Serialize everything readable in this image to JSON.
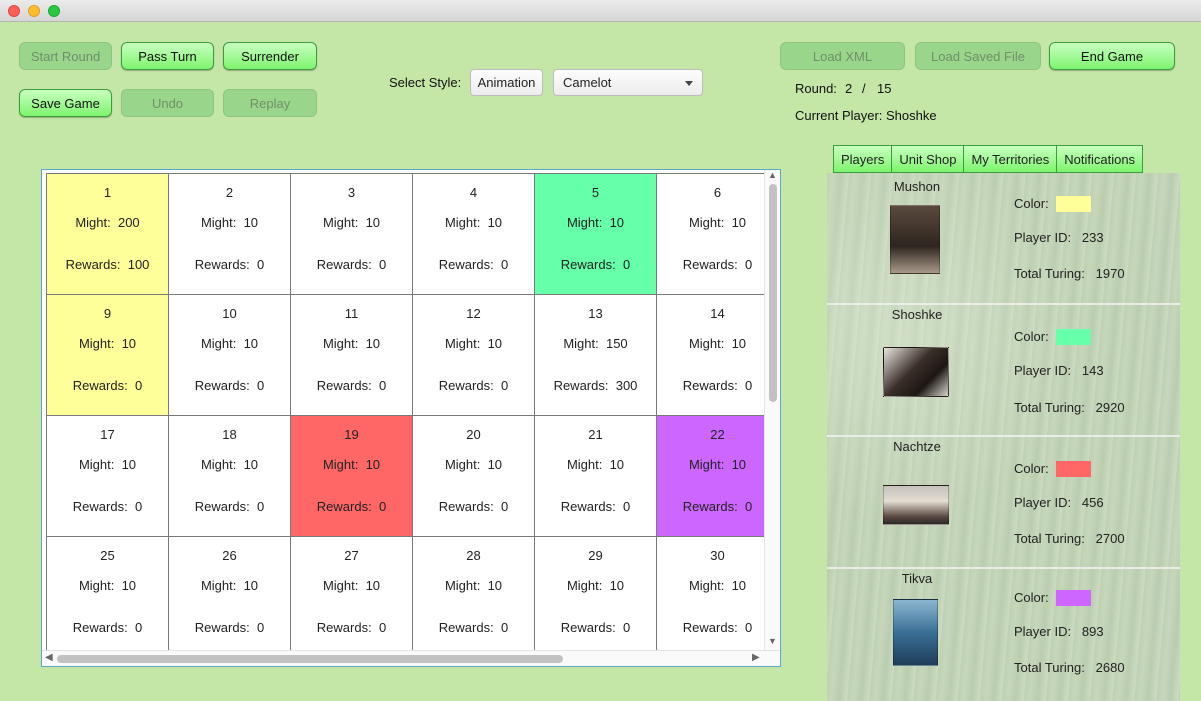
{
  "window": {
    "title": ""
  },
  "toolbar": {
    "start_round": "Start Round",
    "pass_turn": "Pass Turn",
    "surrender": "Surrender",
    "save_game": "Save Game",
    "undo": "Undo",
    "replay": "Replay",
    "load_xml": "Load XML",
    "load_saved_file": "Load Saved File",
    "end_game": "End Game"
  },
  "style": {
    "label": "Select Style:",
    "animation": "Animation",
    "selected": "Camelot"
  },
  "status": {
    "round_label": "Round:",
    "round_current": "2",
    "round_sep": "/",
    "round_total": "15",
    "current_player_label": "Current Player:",
    "current_player": "Shoshke"
  },
  "cell_labels": {
    "might": "Might:",
    "rewards": "Rewards:"
  },
  "board": {
    "cells": [
      {
        "n": "1",
        "might": "200",
        "rewards": "100",
        "owner": "Mushon"
      },
      {
        "n": "2",
        "might": "10",
        "rewards": "0",
        "owner": ""
      },
      {
        "n": "3",
        "might": "10",
        "rewards": "0",
        "owner": ""
      },
      {
        "n": "4",
        "might": "10",
        "rewards": "0",
        "owner": ""
      },
      {
        "n": "5",
        "might": "10",
        "rewards": "0",
        "owner": "Shoshke"
      },
      {
        "n": "6",
        "might": "10",
        "rewards": "0",
        "owner": ""
      },
      {
        "n": "9",
        "might": "10",
        "rewards": "0",
        "owner": "Mushon"
      },
      {
        "n": "10",
        "might": "10",
        "rewards": "0",
        "owner": ""
      },
      {
        "n": "11",
        "might": "10",
        "rewards": "0",
        "owner": ""
      },
      {
        "n": "12",
        "might": "10",
        "rewards": "0",
        "owner": ""
      },
      {
        "n": "13",
        "might": "150",
        "rewards": "300",
        "owner": ""
      },
      {
        "n": "14",
        "might": "10",
        "rewards": "0",
        "owner": ""
      },
      {
        "n": "17",
        "might": "10",
        "rewards": "0",
        "owner": ""
      },
      {
        "n": "18",
        "might": "10",
        "rewards": "0",
        "owner": ""
      },
      {
        "n": "19",
        "might": "10",
        "rewards": "0",
        "owner": "Nachtze"
      },
      {
        "n": "20",
        "might": "10",
        "rewards": "0",
        "owner": ""
      },
      {
        "n": "21",
        "might": "10",
        "rewards": "0",
        "owner": ""
      },
      {
        "n": "22",
        "might": "10",
        "rewards": "0",
        "owner": "Tikva"
      },
      {
        "n": "25",
        "might": "10",
        "rewards": "0",
        "owner": ""
      },
      {
        "n": "26",
        "might": "10",
        "rewards": "0",
        "owner": ""
      },
      {
        "n": "27",
        "might": "10",
        "rewards": "0",
        "owner": ""
      },
      {
        "n": "28",
        "might": "10",
        "rewards": "0",
        "owner": ""
      },
      {
        "n": "29",
        "might": "10",
        "rewards": "0",
        "owner": ""
      },
      {
        "n": "30",
        "might": "10",
        "rewards": "0",
        "owner": ""
      }
    ]
  },
  "tabs": [
    "Players",
    "Unit Shop",
    "My Territories",
    "Notifications"
  ],
  "player_labels": {
    "color": "Color:",
    "id": "Player ID:",
    "turing": "Total Turing:"
  },
  "players": [
    {
      "name": "Mushon",
      "color": "#ffff99",
      "id": "233",
      "turing": "1970"
    },
    {
      "name": "Shoshke",
      "color": "#66ffaa",
      "id": "143",
      "turing": "2920"
    },
    {
      "name": "Nachtze",
      "color": "#ff6666",
      "id": "456",
      "turing": "2700"
    },
    {
      "name": "Tikva",
      "color": "#cc66ff",
      "id": "893",
      "turing": "2680"
    }
  ]
}
